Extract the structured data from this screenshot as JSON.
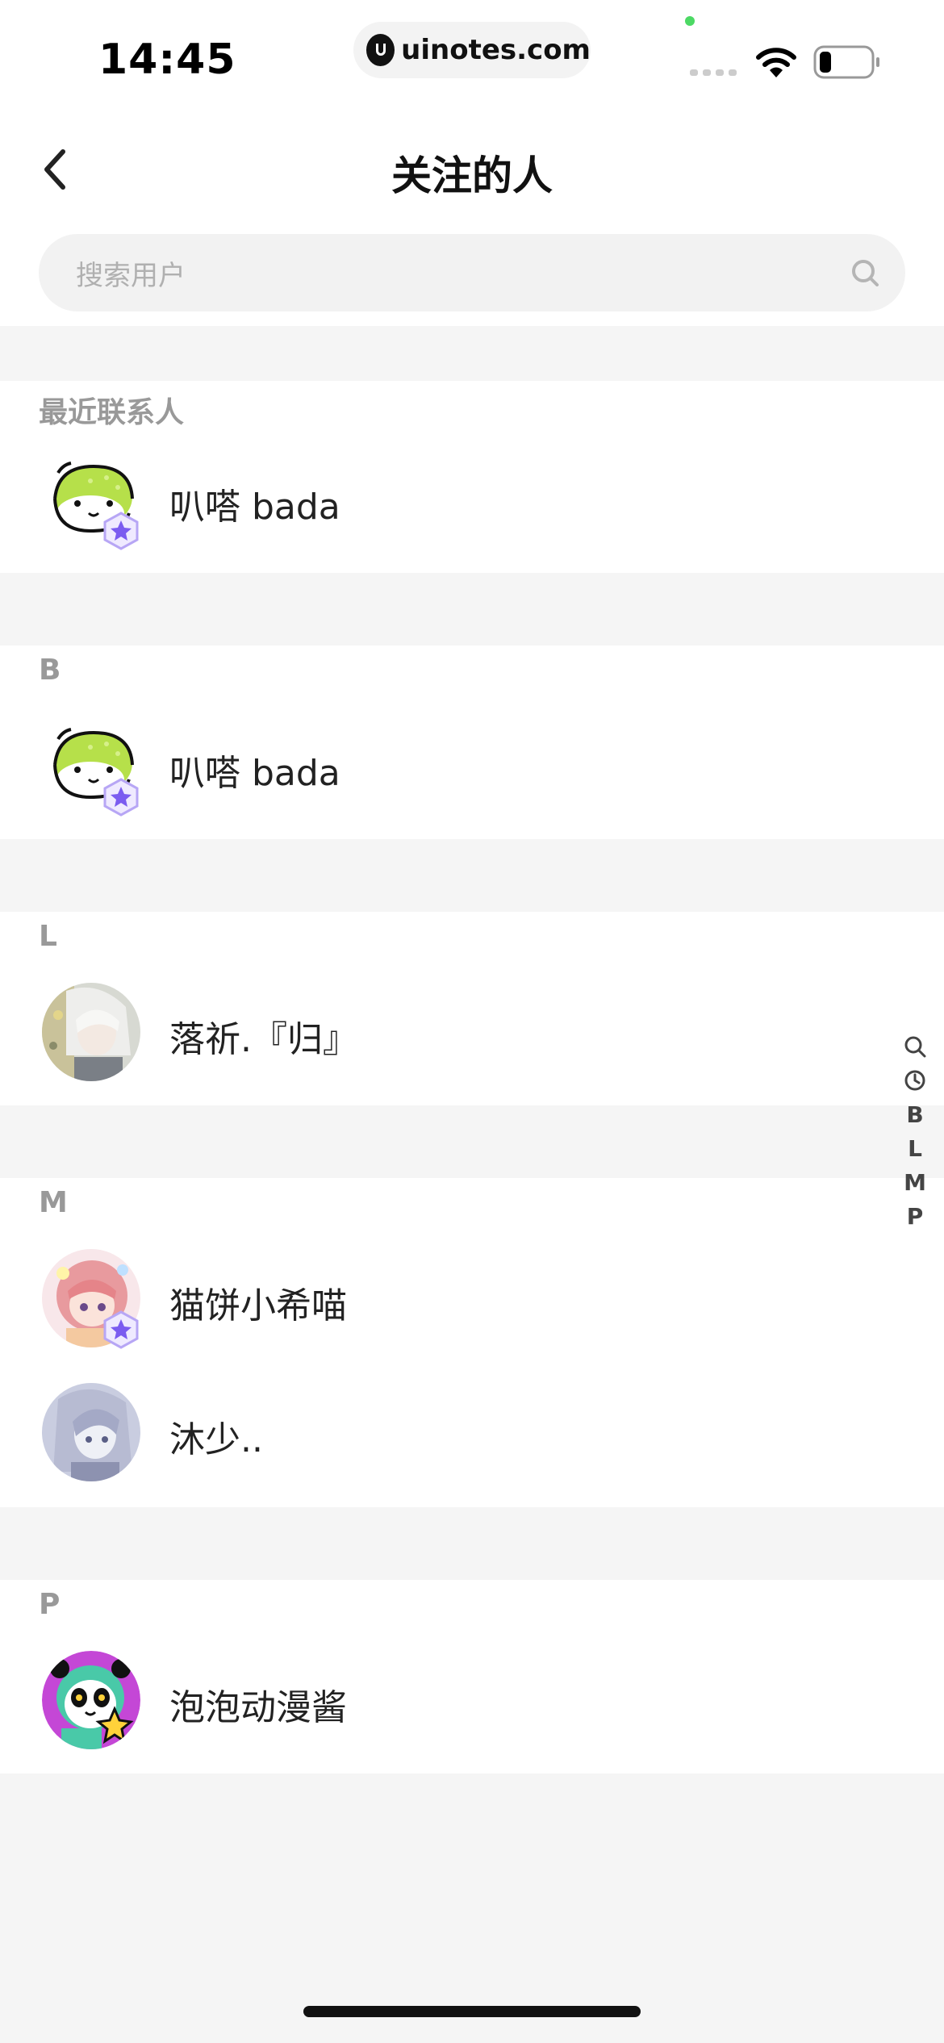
{
  "status_bar": {
    "time": "14:45",
    "url": "uinotes.com",
    "icons": [
      "signal-icon",
      "wifi-icon",
      "battery-icon"
    ],
    "battery_level": 0.2
  },
  "nav": {
    "title": "关注的人",
    "back_icon": "chevron-left-icon"
  },
  "search": {
    "placeholder": "搜索用户",
    "icon": "search-icon"
  },
  "sections": [
    {
      "header": "最近联系人",
      "contacts": [
        {
          "name": "叭嗒 bada",
          "avatar": "bada-avatar",
          "badge": true
        }
      ]
    },
    {
      "header": "B",
      "contacts": [
        {
          "name": "叭嗒 bada",
          "avatar": "bada-avatar",
          "badge": true
        }
      ]
    },
    {
      "header": "L",
      "contacts": [
        {
          "name": "落祈.『归』",
          "avatar": "anime-white-hair-avatar",
          "badge": false
        }
      ]
    },
    {
      "header": "M",
      "contacts": [
        {
          "name": "猫饼小希喵",
          "avatar": "anime-pink-hair-avatar",
          "badge": true
        },
        {
          "name": "沐少..",
          "avatar": "anime-silver-hair-avatar",
          "badge": false
        }
      ]
    },
    {
      "header": "P",
      "contacts": [
        {
          "name": "泡泡动漫酱",
          "avatar": "panda-mascot-avatar",
          "badge": false
        }
      ]
    }
  ],
  "index_bar": [
    "search-icon",
    "clock-icon",
    "B",
    "L",
    "M",
    "P"
  ],
  "colors": {
    "background": "#f5f5f5",
    "section_header": "#999999",
    "badge": "#7b5cf0"
  }
}
